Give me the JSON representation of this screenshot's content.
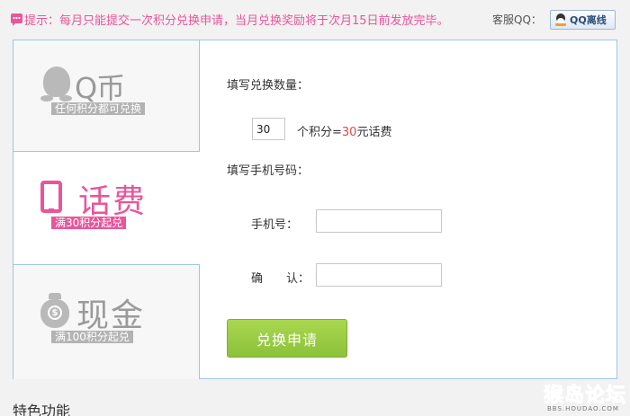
{
  "notice": {
    "text": "提示：每月只能提交一次积分兑换申请，当月兑换奖励将于次月15日前发放完毕。",
    "service_label": "客服QQ：",
    "qq_button_label": "QQ离线"
  },
  "tabs": [
    {
      "title": "Q币",
      "subtitle": "任何积分都可兑换",
      "active": false
    },
    {
      "title": "话费",
      "subtitle": "满30积分起兑",
      "active": true
    },
    {
      "title": "现金",
      "subtitle": "满100积分起兑",
      "active": false
    }
  ],
  "form": {
    "quantity_label": "填写兑换数量：",
    "quantity_value": "30",
    "quantity_suffix_prefix": "个积分=",
    "quantity_amount": "30",
    "quantity_suffix_unit": "元话费",
    "phone_section_label": "填写手机号码：",
    "phone_label": "手机号：",
    "phone_value": "",
    "confirm_label": "确　　认：",
    "confirm_value": "",
    "submit_label": "兑换申请"
  },
  "section": {
    "title": "特色功能"
  },
  "watermark": {
    "main": "猴岛论坛",
    "sub": "BBS.HOUDAO.COM"
  },
  "colors": {
    "accent_pink": "#e9559a",
    "submit_green": "#9ccd45",
    "border_blue": "#9fc7e0",
    "inactive_gray": "#9a9a9a"
  },
  "icons": {
    "notice": "speech-bubble-icon",
    "qq": "qq-penguin-icon",
    "tab_qb": "penguin-icon",
    "tab_hf": "mobile-phone-icon",
    "tab_xj": "money-bag-icon"
  }
}
